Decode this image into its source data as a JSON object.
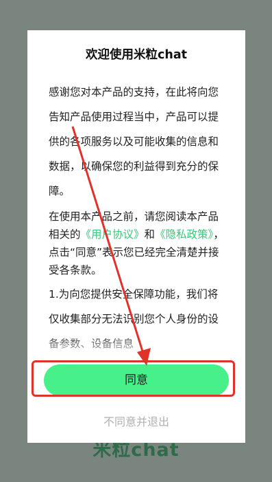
{
  "background": {
    "app_name": "米粒chat"
  },
  "dialog": {
    "title": "欢迎使用米粒chat",
    "paragraph1": "感谢您对本产品的支持，在此将向您告知产品使用过程当中，产品可以提供的各项服务以及可能收集的信息和数据，以确保您的利益得到充分的保障。",
    "paragraph2": {
      "prefix": "在使用本产品之前，请您阅读本产品相关的",
      "user_agreement_link": "《用户协议》",
      "and": "和",
      "privacy_policy_link": "《隐私政策》",
      "suffix": "，点击“同意”表示您已经完全清楚并接受各条款。"
    },
    "paragraph3": "1.为向您提供安全保障功能，我们将仅收集部分无法识别您个人身份的设备参数、设备信息",
    "agree_button": "同意",
    "decline_link": "不同意并退出"
  },
  "colors": {
    "overlay": "#7a8580",
    "accent_button": "#48f08a",
    "link": "#3cc47a",
    "annotation_red": "#e0322a"
  }
}
